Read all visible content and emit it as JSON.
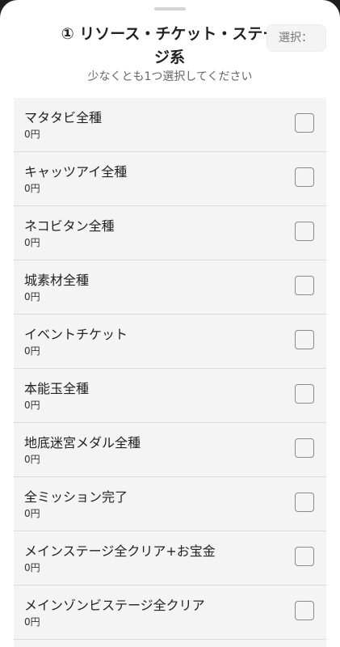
{
  "sheet": {
    "title": "① リソース・チケット・ステージ系",
    "subtitle": "少なくとも1つ選択してください",
    "selected_label": "選択："
  },
  "items": [
    {
      "name": "マタタビ全種",
      "price": "0円"
    },
    {
      "name": "キャッツアイ全種",
      "price": "0円"
    },
    {
      "name": "ネコビタン全種",
      "price": "0円"
    },
    {
      "name": "城素材全種",
      "price": "0円"
    },
    {
      "name": "イベントチケット",
      "price": "0円"
    },
    {
      "name": "本能玉全種",
      "price": "0円"
    },
    {
      "name": "地底迷宮メダル全種",
      "price": "0円"
    },
    {
      "name": "全ミッション完了",
      "price": "0円"
    },
    {
      "name": "メインステージ全クリア+お宝金",
      "price": "0円"
    },
    {
      "name": "メインゾンビステージ全クリア",
      "price": "0円"
    }
  ]
}
